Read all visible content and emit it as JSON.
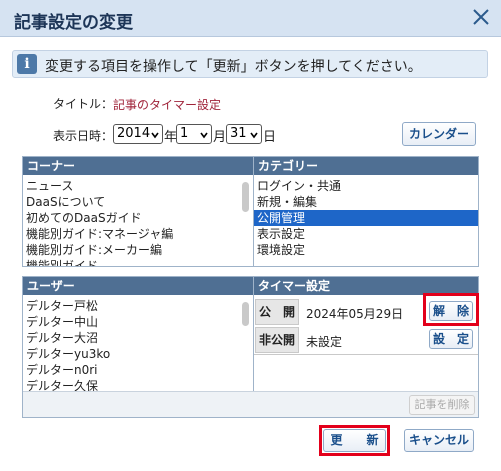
{
  "dialog": {
    "title": "記事設定の変更",
    "info": "変更する項目を操作して「更新」ボタンを押してください。"
  },
  "form": {
    "title_label": "タイトル：",
    "title_value": "記事のタイマー設定",
    "date_label": "表示日時：",
    "year": "2014",
    "year_unit": "年",
    "month": "1",
    "month_unit": "月",
    "day": "31",
    "day_unit": "日",
    "calendar_button": "カレンダー"
  },
  "corner": {
    "header": "コーナー",
    "items": [
      "ニュース",
      "DaaSについて",
      "初めてのDaaSガイド",
      "機能別ガイド:マネージャ編",
      "機能別ガイド:メーカー編",
      "機能別ガイド..."
    ]
  },
  "category": {
    "header": "カテゴリー",
    "items": [
      "ログイン・共通",
      "新規・編集",
      "公開管理",
      "表示設定",
      "環境設定"
    ],
    "selected_index": 2
  },
  "user": {
    "header": "ユーザー",
    "items": [
      "デルター戸松",
      "デルター中山",
      "デルター大沼",
      "デルターyu3ko",
      "デルターn0ri",
      "デルター久保"
    ]
  },
  "timer": {
    "header": "タイマー設定",
    "publish_label": "公　開",
    "publish_value": "2024年05月29日",
    "release_button": "解　除",
    "unpublish_label": "非公開",
    "unpublish_value": "未設定",
    "set_button": "設　定",
    "delete_button": "記事を削除"
  },
  "footer": {
    "update_button": "更　　新",
    "cancel_button": "キャンセル"
  },
  "colors": {
    "header_bg": "#4f6f93",
    "selection": "#1e66c8",
    "highlight_border": "#e3001b",
    "title_red": "#a0243a"
  }
}
